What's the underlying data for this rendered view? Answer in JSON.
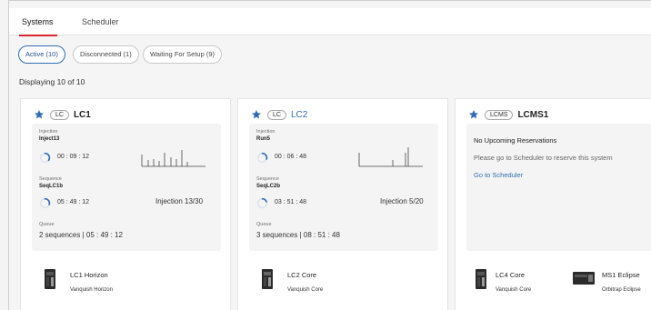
{
  "tabs": [
    {
      "label": "Systems",
      "active": true
    },
    {
      "label": "Scheduler",
      "active": false
    }
  ],
  "filters": [
    {
      "label": "Active (10)",
      "active": true
    },
    {
      "label": "Disconnected (1)",
      "active": false
    },
    {
      "label": "Waiting For Setup (9)",
      "active": false
    }
  ],
  "displaying": "Displaying 10 of 10",
  "accent_color": "#d9262e",
  "link_color": "#2f6db5",
  "cards": [
    {
      "type_badge": "LC",
      "name": "LC1",
      "injection_label": "Injection",
      "injection_name": "Inject13",
      "injection_time": "00 : 09 : 12",
      "injection_progress": 0.35,
      "sequence_label": "Sequence",
      "sequence_name": "SeqLC1b",
      "sequence_time": "05 : 49 : 12",
      "sequence_progress": 0.3,
      "injection_count": "Injection 13/30",
      "queue_label": "Queue",
      "queue_value": "2 sequences | 05 : 49 : 12",
      "module_name": "LC1 Horizon",
      "module_sub": "Vanquish Horizon",
      "module_icon": "instrument-icon"
    },
    {
      "type_badge": "LC",
      "name": "LC2",
      "injection_label": "Injection",
      "injection_name": "Run5",
      "injection_time": "00 : 06 : 48",
      "injection_progress": 0.3,
      "sequence_label": "Sequence",
      "sequence_name": "SeqLC2b",
      "sequence_time": "03 : 51 : 48",
      "sequence_progress": 0.2,
      "injection_count": "Injection 5/20",
      "queue_label": "Queue",
      "queue_value": "3 sequences | 08 : 51 : 48",
      "module_name": "LC2 Core",
      "module_sub": "Vanquish Core",
      "module_icon": "instrument-icon"
    },
    {
      "type_badge": "LCMS",
      "name": "LCMS1",
      "no_reservations": "No Upcoming Reservations",
      "no_reservations_msg": "Please go to Scheduler to reserve this system",
      "scheduler_link": "Go to Scheduler",
      "modules": [
        {
          "name": "LC4 Core",
          "sub": "Vanquish Core",
          "icon": "instrument-icon"
        },
        {
          "name": "MS1 Eclipse",
          "sub": "Orbitrap Eclipse",
          "icon": "mass-spec-icon"
        }
      ]
    }
  ]
}
